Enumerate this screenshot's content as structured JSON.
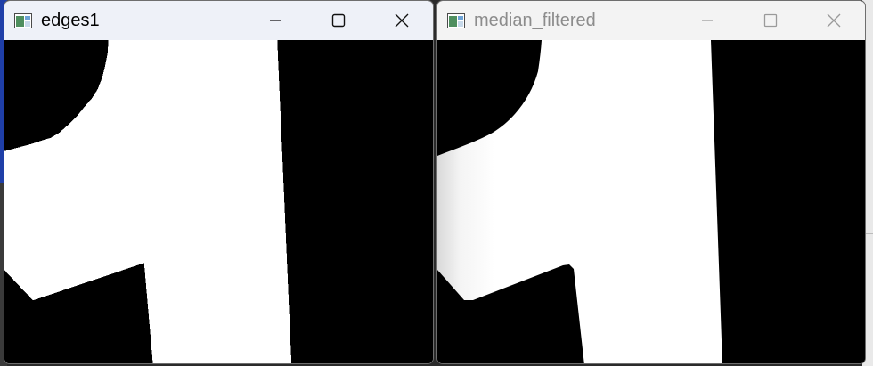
{
  "windows": [
    {
      "title": "edges1",
      "active": true,
      "icon": "app-window-icon",
      "controls": [
        "minimize-icon",
        "maximize-icon",
        "close-icon"
      ]
    },
    {
      "title": "median_filtered",
      "active": false,
      "icon": "app-window-icon",
      "controls": [
        "minimize-icon",
        "maximize-icon",
        "close-icon"
      ]
    }
  ],
  "colors": {
    "image_background": "#000000",
    "image_foreground": "#ffffff",
    "active_title_text": "#000000",
    "inactive_title_text": "#8c8c8c"
  }
}
